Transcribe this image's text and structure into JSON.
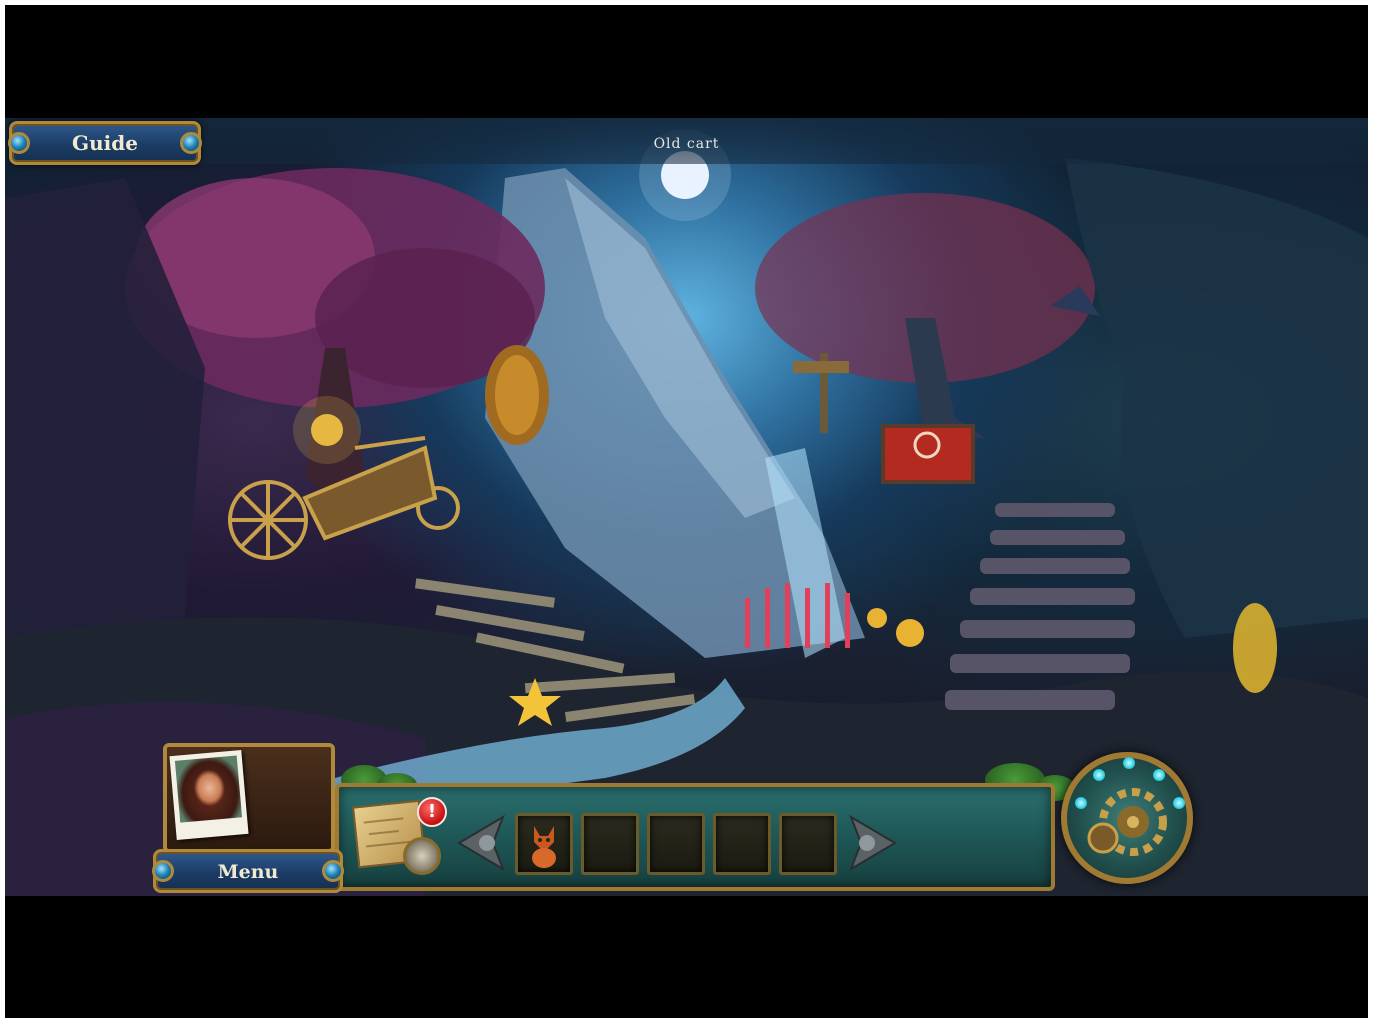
{
  "top_bar": {
    "guide_label": "Guide",
    "location_label": "Old cart"
  },
  "hud": {
    "menu_label": "Menu",
    "alert_badge": "!",
    "inventory_slots": [
      {
        "item": "fox-figurine"
      },
      {
        "item": ""
      },
      {
        "item": ""
      },
      {
        "item": ""
      },
      {
        "item": ""
      }
    ]
  },
  "icons": {
    "map": "map-icon",
    "compass": "compass-icon",
    "hint": "hint-gear-icon",
    "scroll_left": "arrow-left-icon",
    "scroll_right": "arrow-right-icon"
  },
  "colors": {
    "panel_teal": "#1e5756",
    "frame_gold": "#b08a3a",
    "button_blue": "#1c3c66",
    "alert_red": "#c40f0f"
  }
}
